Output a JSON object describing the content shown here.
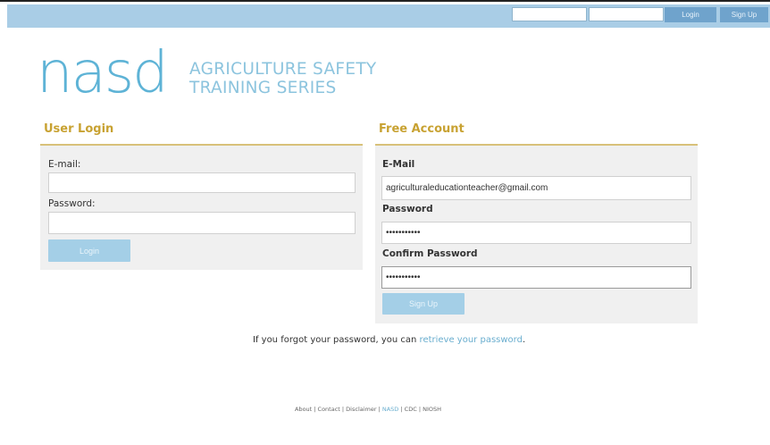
{
  "header": {
    "email_value": "",
    "password_value": "",
    "login_label": "Login",
    "signup_label": "Sign Up"
  },
  "logo": {
    "word": "nasd",
    "tagline_line1": "AGRICULTURE SAFETY",
    "tagline_line2": "TRAINING SERIES"
  },
  "user_login": {
    "title": "User Login",
    "email_label": "E-mail:",
    "email_value": "",
    "password_label": "Password:",
    "password_value": "",
    "button_label": "Login"
  },
  "free_account": {
    "title": "Free Account",
    "email_label": "E-Mail",
    "email_value": "agriculturaleducationteacher@gmail.com",
    "password_label": "Password",
    "password_value": "•••••••••••",
    "confirm_label": "Confirm Password",
    "confirm_value": "•••••••••••",
    "button_label": "Sign Up"
  },
  "forgot": {
    "prefix": "If you forgot your password, you can ",
    "link": "retrieve your password",
    "suffix": "."
  },
  "footer": {
    "links": [
      "About",
      "Contact",
      "Disclaimer",
      "NASD",
      "CDC",
      "NIOSH"
    ],
    "separator": " | "
  },
  "colors": {
    "topbar": "#a9cde6",
    "accent_gold": "#c8a232",
    "logo_blue": "#5eb3d6",
    "button_blue": "#a4cfe7"
  }
}
